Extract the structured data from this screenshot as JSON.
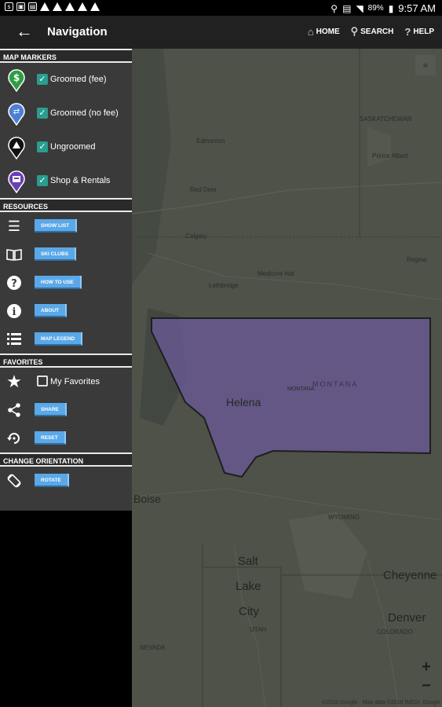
{
  "status_bar": {
    "battery": "89%",
    "time": "9:57 AM"
  },
  "app_bar": {
    "title": "Navigation",
    "actions": [
      {
        "label": "HOME",
        "icon": "home-icon"
      },
      {
        "label": "SEARCH",
        "icon": "search-icon"
      },
      {
        "label": "HELP",
        "icon": "help-icon"
      }
    ]
  },
  "sections": {
    "map_markers": "MAP MARKERS",
    "resources": "RESOURCES",
    "favorites": "FAVORITES",
    "orientation": "CHANGE ORIENTATION"
  },
  "map_markers": [
    {
      "label": "Groomed (fee)",
      "checked": true,
      "icon": "groomed-fee-marker-icon",
      "color": "#2e9e44",
      "glyph": "$"
    },
    {
      "label": "Groomed (no fee)",
      "checked": true,
      "icon": "groomed-no-fee-marker-icon",
      "color": "#4d7fd6",
      "glyph": "⇄"
    },
    {
      "label": "Ungroomed",
      "checked": true,
      "icon": "ungroomed-marker-icon",
      "color": "#111111",
      "glyph": "▲"
    },
    {
      "label": "Shop & Rentals",
      "checked": true,
      "icon": "shop-rentals-marker-icon",
      "color": "#6a3fb5",
      "glyph": "🛍"
    }
  ],
  "resources": [
    {
      "label": "SHOW LIST",
      "icon": "list-icon",
      "glyph": "☰"
    },
    {
      "label": "SKI CLUBS",
      "icon": "book-icon",
      "glyph": "📖"
    },
    {
      "label": "HOW TO USE",
      "icon": "question-icon",
      "glyph": "?"
    },
    {
      "label": "ABOUT",
      "icon": "info-icon",
      "glyph": "i"
    },
    {
      "label": "MAP LEGEND",
      "icon": "legend-list-icon",
      "glyph": "☷"
    }
  ],
  "favorites": {
    "my_favorites": {
      "label": "My Favorites",
      "checked": false
    },
    "share": "SHARE",
    "reset": "RESET"
  },
  "orientation": {
    "rotate": "ROTATE"
  },
  "map": {
    "labels": {
      "saskatchewan": "SASKATCHEWAN",
      "edmonton": "Edmonton",
      "red_deer": "Red Deer",
      "calgary": "Calgary",
      "lethbridge": "Lethbridge",
      "medicine_hat": "Medicine Hat",
      "prince_albert": "Prince Albert",
      "regina": "Regina",
      "helena": "Helena",
      "montana_state": "MONTANA",
      "montana": "MONTANA",
      "boise": "Boise",
      "salt_lake_city_1": "Salt",
      "salt_lake_city_2": "Lake",
      "salt_lake_city_3": "City",
      "cheyenne": "Cheyenne",
      "denver": "Denver",
      "colorado": "COLORADO",
      "wyoming": "WYOMING",
      "utah": "UTAH",
      "nevada": "NEVADA"
    },
    "zoom_in": "+",
    "zoom_out": "−",
    "attribution": "©2018 Google · Map data ©2018 INEGI, Google",
    "region_color": "#6b5a9a"
  }
}
